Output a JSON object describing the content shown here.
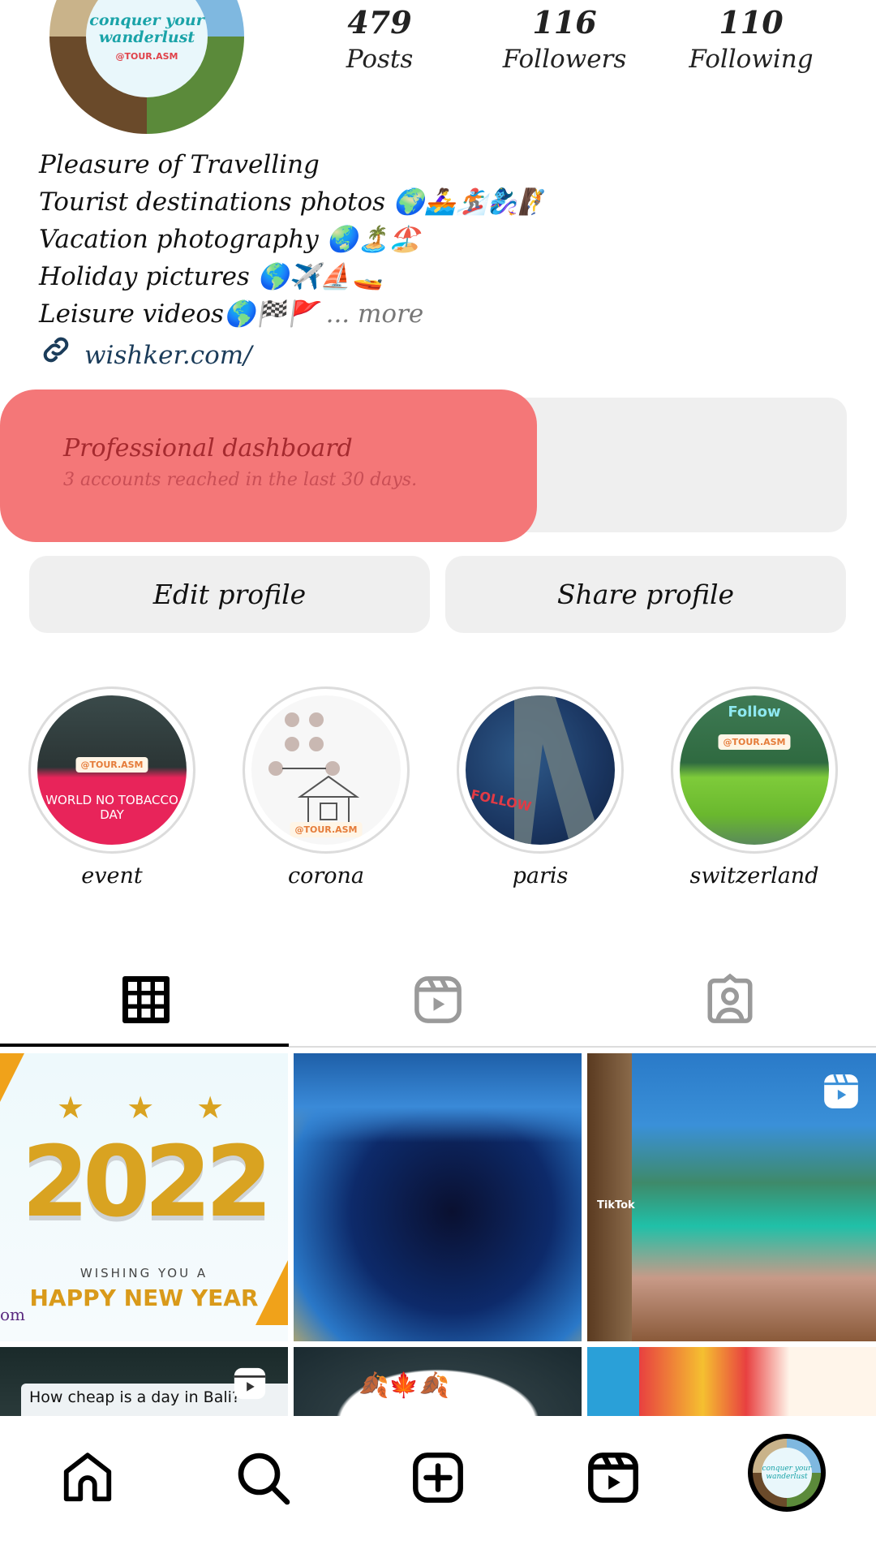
{
  "profile": {
    "avatar": {
      "text": "conquer your wanderlust",
      "tag": "@TOUR.ASM"
    },
    "stats": [
      {
        "value": "479",
        "label": "Posts"
      },
      {
        "value": "116",
        "label": "Followers"
      },
      {
        "value": "110",
        "label": "Following"
      }
    ],
    "bio": {
      "lines": [
        {
          "text": "Pleasure of Travelling",
          "emoji": ""
        },
        {
          "text": "Tourist destinations photos ",
          "emoji": "🌍🚣‍♀️🏂🧞‍♀️🧗"
        },
        {
          "text": "Vacation photography ",
          "emoji": "🌏🏝️🏖️"
        },
        {
          "text": "Holiday pictures ",
          "emoji": "🌎✈️⛵🚤"
        },
        {
          "text": "Leisure videos",
          "emoji": "🌎🏁🚩"
        }
      ],
      "more_label": "... more",
      "link_icon": "link-icon",
      "link": "wishker.com/"
    }
  },
  "professional_dashboard": {
    "title": "Professional dashboard",
    "subtitle": "3 accounts reached in the last 30 days.",
    "highlight_color": "#f47778"
  },
  "buttons": {
    "edit_profile": "Edit profile",
    "share_profile": "Share profile"
  },
  "highlights": [
    {
      "label": "event",
      "badge": "@TOUR.ASM",
      "caption": "WORLD NO TOBACCO DAY"
    },
    {
      "label": "corona",
      "badge": "@TOUR.ASM",
      "caption": ""
    },
    {
      "label": "paris",
      "badge": "",
      "caption": "FOLLOW"
    },
    {
      "label": "switzerland",
      "badge": "@TOUR.ASM",
      "caption": "Follow"
    }
  ],
  "tabs": [
    {
      "name": "posts-grid",
      "icon": "grid-icon",
      "active": true
    },
    {
      "name": "reels",
      "icon": "reels-icon",
      "active": false
    },
    {
      "name": "tagged",
      "icon": "tagged-person-icon",
      "active": false
    }
  ],
  "grid": [
    {
      "name": "post-new-year-2022",
      "caption_top": "2022",
      "caption_mid": "WISHING YOU A",
      "caption_main": "HAPPY NEW YEAR",
      "side_text": "om",
      "is_reel": false
    },
    {
      "name": "post-city-marina-night",
      "is_reel": false
    },
    {
      "name": "post-waterfall-lagoon",
      "overlay": "TikTok",
      "is_reel": true
    },
    {
      "name": "post-bali-reel",
      "overlay": "How cheap is a day in Bali?",
      "is_reel": true
    },
    {
      "name": "post-autumn-leaves",
      "is_reel": false
    },
    {
      "name": "post-colorful-pattern",
      "is_reel": false
    }
  ],
  "bottom_nav": [
    {
      "name": "home",
      "icon": "home-icon"
    },
    {
      "name": "search",
      "icon": "search-icon"
    },
    {
      "name": "create",
      "icon": "plus-square-icon"
    },
    {
      "name": "reels",
      "icon": "reels-icon"
    },
    {
      "name": "profile",
      "icon": "profile-avatar",
      "text": "conquer your wanderlust"
    }
  ]
}
